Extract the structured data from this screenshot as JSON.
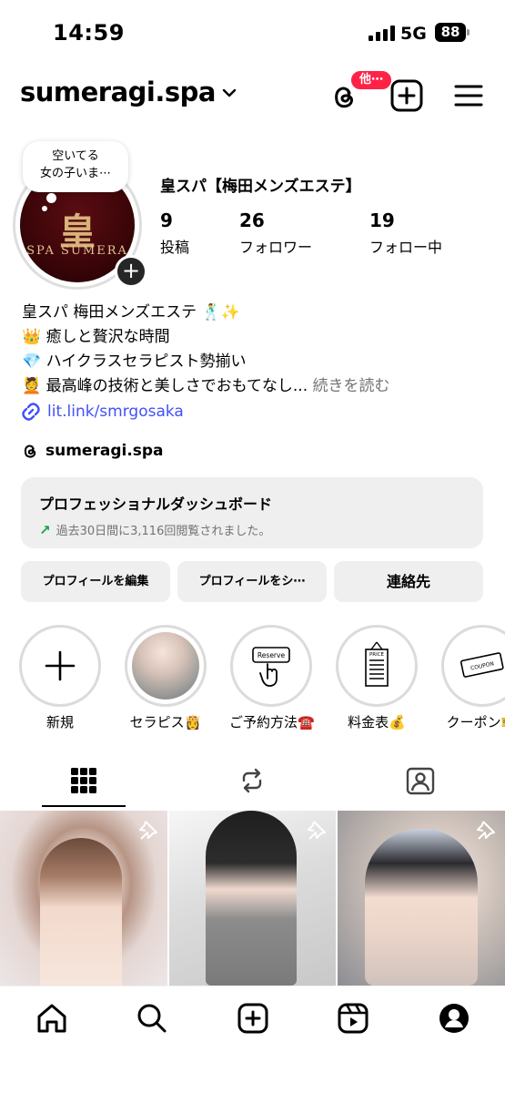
{
  "status_bar": {
    "time": "14:59",
    "network": "5G",
    "battery": "88"
  },
  "header": {
    "username": "sumeragi.spa",
    "notification_badge": "他⋯"
  },
  "profile": {
    "note": "空いてる\n女の子いま⋯",
    "avatar_logo": "皇",
    "avatar_sub": "SPA SUMERA",
    "display_name": "皇スパ【梅田メンズエステ】",
    "stats": [
      {
        "value": "9",
        "label": "投稿"
      },
      {
        "value": "26",
        "label": "フォロワー"
      },
      {
        "value": "19",
        "label": "フォロー中"
      }
    ],
    "bio_lines": [
      "皇スパ 梅田メンズエステ 🕺✨",
      "👑 癒しと贅沢な時間",
      "💎 ハイクラスセラピスト勢揃い",
      "💆 最高峰の技術と美しさでおもてなし..."
    ],
    "bio_more": "続きを読む",
    "link": "lit.link/smrgosaka",
    "threads_handle": "sumeragi.spa"
  },
  "dashboard": {
    "title": "プロフェッショナルダッシュボード",
    "subtitle": "過去30日間に3,116回閲覧されました。"
  },
  "buttons": {
    "edit_profile": "プロフィールを編集",
    "share_profile": "プロフィールをシ⋯",
    "contact": "連絡先"
  },
  "highlights": [
    {
      "label": "新規"
    },
    {
      "label": "セラピス👸"
    },
    {
      "label": "ご予約方法☎️"
    },
    {
      "label": "料金表💰"
    },
    {
      "label": "クーポン🎫"
    }
  ],
  "highlight_texts": {
    "reserve": "Reserve",
    "price": "PRICE",
    "coupon": "COUPON"
  },
  "colors": {
    "accent_link": "#4150f7",
    "badge_red": "#ff2146",
    "button_bg": "#efefef",
    "trend_green": "#17a34a"
  },
  "icons": {
    "tabs": [
      "grid-icon",
      "reels-icon",
      "tagged-icon"
    ],
    "bottom_nav": [
      "home-icon",
      "search-icon",
      "create-icon",
      "reels-icon",
      "profile-icon"
    ]
  }
}
